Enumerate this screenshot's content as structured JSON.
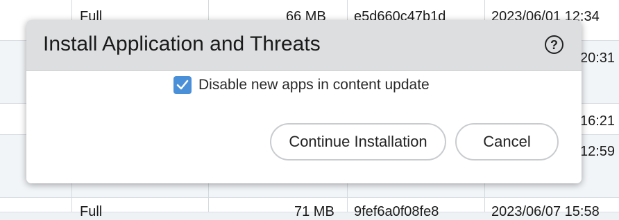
{
  "background_table": {
    "rows": [
      {
        "type": "Full",
        "size": "66 MB",
        "hash": "e5d660c47b1d",
        "time": "2023/06/01 12:34"
      },
      {
        "time_partial": "20:31"
      },
      {
        "time_partial": "16:21"
      },
      {
        "time_partial": "12:59"
      },
      {
        "type": "Full",
        "size": "71 MB",
        "hash": "9fef6a0f08fe8",
        "time": "2023/06/07 15:58"
      }
    ]
  },
  "dialog": {
    "title": "Install Application and Threats",
    "help_icon": "question-circle-icon",
    "checkbox": {
      "label": "Disable new apps in content update",
      "checked": true
    },
    "buttons": {
      "continue": "Continue Installation",
      "cancel": "Cancel"
    }
  },
  "colors": {
    "accent": "#4a90d9",
    "header_bg": "#dcdee0"
  }
}
